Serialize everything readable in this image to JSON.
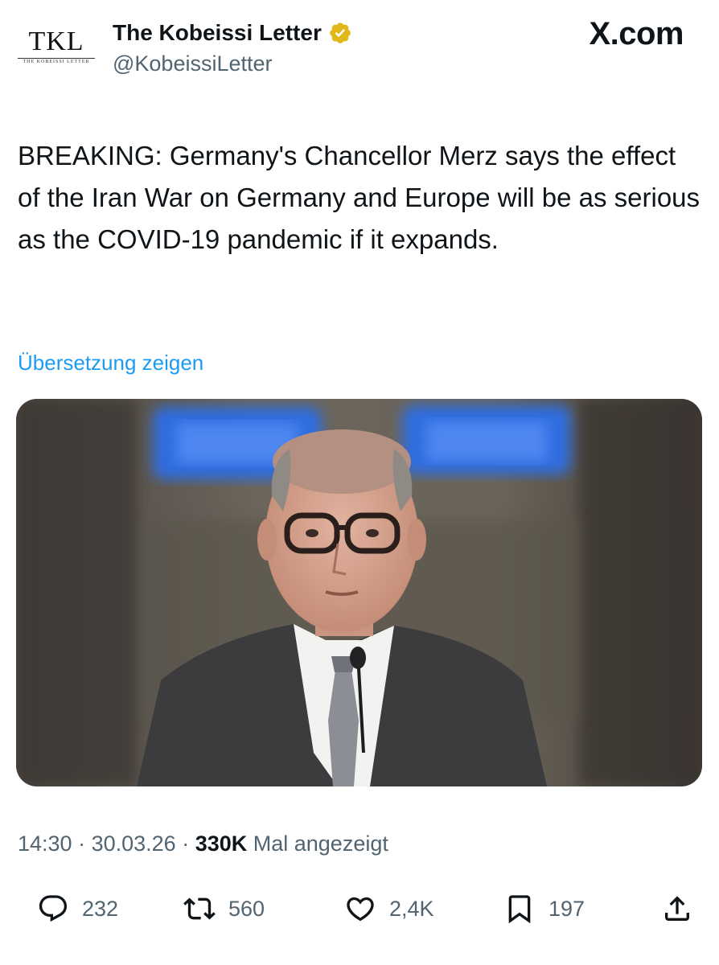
{
  "author": {
    "avatar_text": "TKL",
    "avatar_subtext": "THE KOBEISSI LETTER",
    "name": "The Kobeissi Letter",
    "handle": "@KobeissiLetter"
  },
  "watermark": "X.com",
  "tweet": {
    "text": "BREAKING: Germany's Chancellor Merz says the effect of the Iran War on Germany and Europe will be as serious as the COVID-19 pandemic if it expands.",
    "translate_label": "Übersetzung zeigen"
  },
  "meta": {
    "time": "14:30",
    "separator": " · ",
    "date": "30.03.26",
    "views_count": "330K",
    "views_label": "Mal angezeigt"
  },
  "actions": {
    "replies": "232",
    "reposts": "560",
    "likes": "2,4K",
    "bookmarks": "197"
  },
  "colors": {
    "link": "#1d9bf0",
    "secondary": "#536471",
    "verified": "#e2b719"
  },
  "icons": [
    "verified-badge-icon",
    "reply-icon",
    "repost-icon",
    "like-icon",
    "bookmark-icon",
    "share-icon"
  ]
}
